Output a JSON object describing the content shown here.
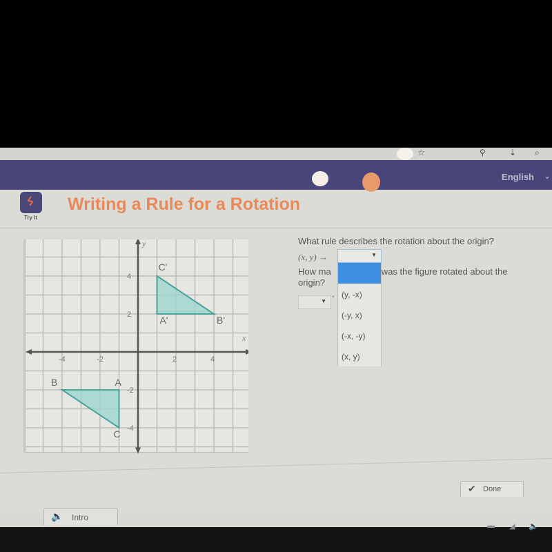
{
  "browser": {
    "icons": [
      "star-icon",
      "extension-icon",
      "download-icon",
      "search-icon"
    ]
  },
  "nav": {
    "language": "English"
  },
  "activity": {
    "badge_label": "Try It",
    "title": "Writing a Rule for a Rotation"
  },
  "question1": {
    "text": "What rule describes the rotation about the origin?",
    "prefix": "(x, y) →",
    "selected_value": "",
    "options": [
      "",
      "(y, -x)",
      "(-y, x)",
      "(-x, -y)",
      "(x, y)"
    ]
  },
  "question2": {
    "text_before": "How ma",
    "text_after": "s was the figure rotated about the origin?",
    "selected_value": "",
    "unit": "°"
  },
  "buttons": {
    "done": "Done",
    "intro": "Intro"
  },
  "colors": {
    "nav": "#48457a",
    "title": "#e8895a",
    "triangle_fill": "#9fd6d0",
    "triangle_stroke": "#4aa39a",
    "dropdown_highlight": "#3d8ee0"
  },
  "chart_data": {
    "type": "scatter",
    "title": "",
    "xlabel": "x",
    "ylabel": "y",
    "xlim": [
      -6,
      6
    ],
    "ylim": [
      -5,
      6
    ],
    "x_ticks": [
      -4,
      -2,
      2,
      4
    ],
    "y_ticks": [
      -4,
      -2,
      2,
      4
    ],
    "grid": true,
    "polygons": [
      {
        "name": "ABC",
        "points": [
          {
            "label": "A",
            "x": -1,
            "y": -2
          },
          {
            "label": "B",
            "x": -4,
            "y": -2
          },
          {
            "label": "C",
            "x": -1,
            "y": -4
          }
        ]
      },
      {
        "name": "A'B'C'",
        "points": [
          {
            "label": "A'",
            "x": 1,
            "y": 2
          },
          {
            "label": "B'",
            "x": 4,
            "y": 2
          },
          {
            "label": "C'",
            "x": 1,
            "y": 4
          }
        ]
      }
    ]
  }
}
